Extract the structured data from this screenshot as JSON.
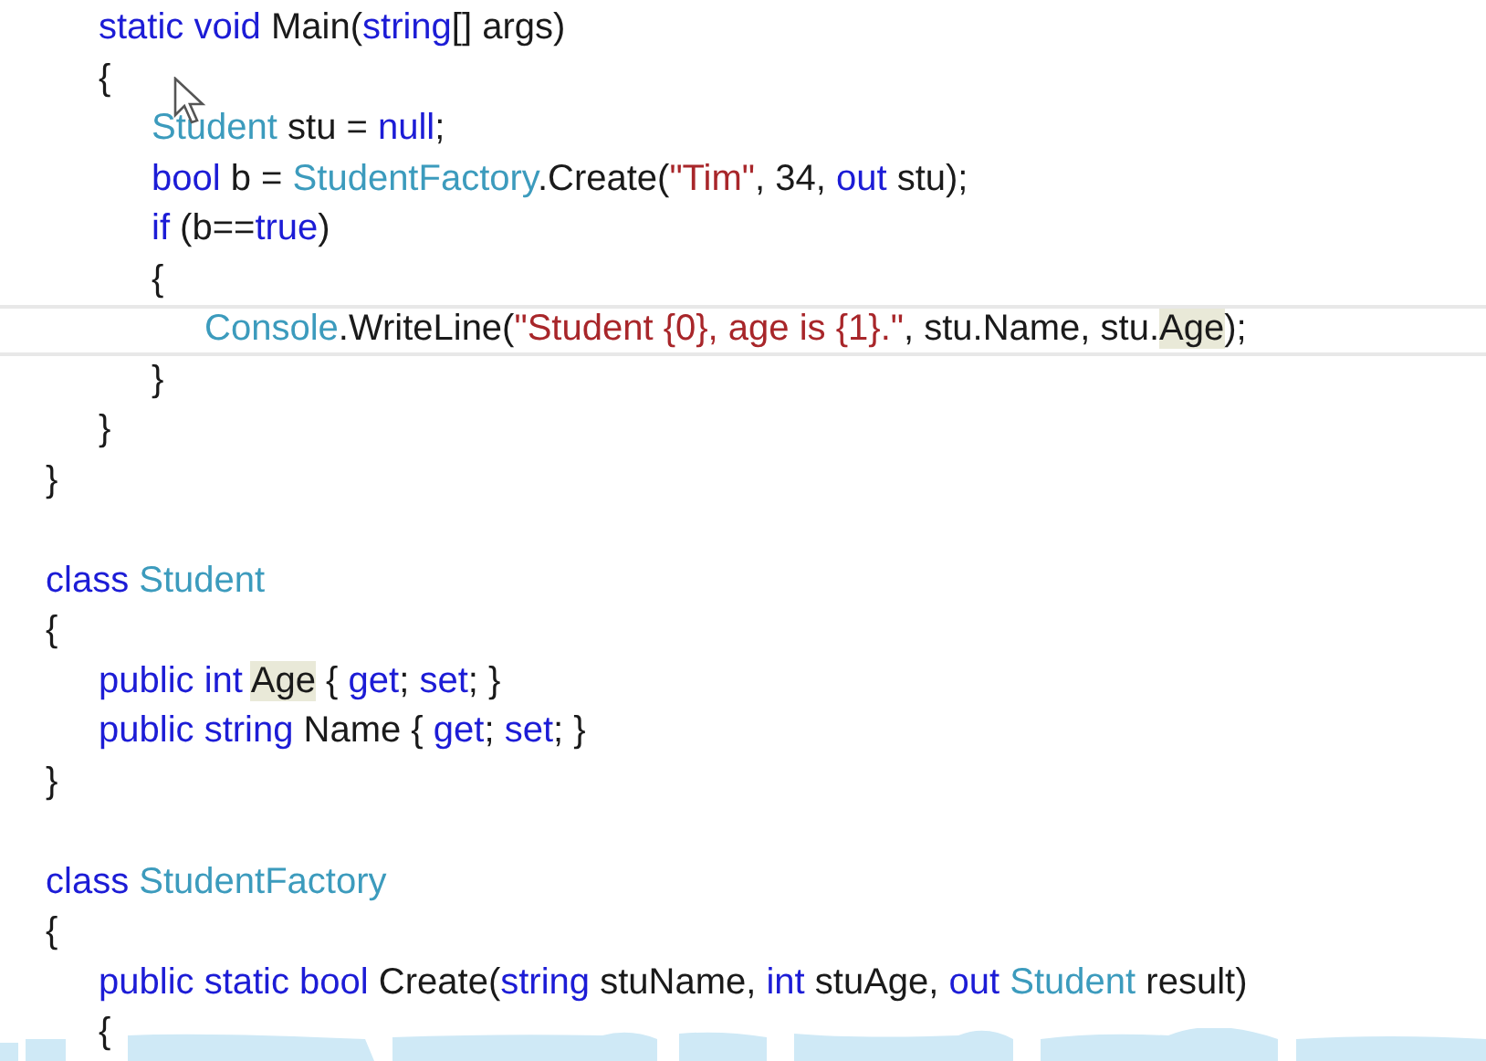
{
  "editor": {
    "lines": [
      {
        "kind": "block",
        "children": [
          {
            "kind": "line",
            "tokens": [
              {
                "text": "static void",
                "kind": "keyword"
              },
              {
                "text": " Main(",
                "kind": "plain"
              },
              {
                "text": "string",
                "kind": "keyword"
              },
              {
                "text": "[] args)",
                "kind": "plain"
              }
            ]
          },
          {
            "kind": "line",
            "tokens": [
              {
                "text": "{",
                "kind": "plain"
              }
            ]
          },
          {
            "kind": "block",
            "children": [
              {
                "kind": "line",
                "tokens": [
                  {
                    "text": "Student",
                    "kind": "type"
                  },
                  {
                    "text": " stu = ",
                    "kind": "plain"
                  },
                  {
                    "text": "null",
                    "kind": "keyword"
                  },
                  {
                    "text": ";",
                    "kind": "plain"
                  }
                ]
              },
              {
                "kind": "line",
                "tokens": [
                  {
                    "text": "bool",
                    "kind": "keyword"
                  },
                  {
                    "text": " b = ",
                    "kind": "plain"
                  },
                  {
                    "text": "StudentFactory",
                    "kind": "type"
                  },
                  {
                    "text": ".Create(",
                    "kind": "plain"
                  },
                  {
                    "text": "\"Tim\"",
                    "kind": "string"
                  },
                  {
                    "text": ", 34, ",
                    "kind": "plain"
                  },
                  {
                    "text": "out",
                    "kind": "keyword"
                  },
                  {
                    "text": " stu);",
                    "kind": "plain"
                  }
                ]
              },
              {
                "kind": "line",
                "tokens": [
                  {
                    "text": "if",
                    "kind": "keyword"
                  },
                  {
                    "text": " (b==",
                    "kind": "plain"
                  },
                  {
                    "text": "true",
                    "kind": "keyword"
                  },
                  {
                    "text": ")",
                    "kind": "plain"
                  }
                ]
              },
              {
                "kind": "line",
                "tokens": [
                  {
                    "text": "{",
                    "kind": "plain"
                  }
                ]
              },
              {
                "kind": "block",
                "children": [
                  {
                    "kind": "line",
                    "current": true,
                    "tokens": [
                      {
                        "text": "Console",
                        "kind": "type"
                      },
                      {
                        "text": ".WriteLine(",
                        "kind": "plain"
                      },
                      {
                        "text": "\"Student {0}, age is {1}.\"",
                        "kind": "string"
                      },
                      {
                        "text": ", stu.Name, stu.",
                        "kind": "plain"
                      },
                      {
                        "text": "Age",
                        "kind": "plain",
                        "highlighted": true
                      },
                      {
                        "text": ");",
                        "kind": "plain"
                      }
                    ]
                  }
                ]
              },
              {
                "kind": "line",
                "tokens": [
                  {
                    "text": "}",
                    "kind": "plain"
                  }
                ]
              }
            ]
          },
          {
            "kind": "line",
            "tokens": [
              {
                "text": "}",
                "kind": "plain"
              }
            ]
          }
        ]
      },
      {
        "kind": "line",
        "tokens": [
          {
            "text": "}",
            "kind": "plain"
          }
        ]
      },
      {
        "kind": "blank"
      },
      {
        "kind": "line",
        "tokens": [
          {
            "text": "class",
            "kind": "keyword"
          },
          {
            "text": " Student",
            "kind": "type"
          }
        ]
      },
      {
        "kind": "line",
        "tokens": [
          {
            "text": "{",
            "kind": "plain"
          }
        ]
      },
      {
        "kind": "block",
        "children": [
          {
            "kind": "line",
            "tokens": [
              {
                "text": "public int ",
                "kind": "keyword"
              },
              {
                "text": "Age",
                "kind": "plain",
                "highlighted": true
              },
              {
                "text": " { ",
                "kind": "plain"
              },
              {
                "text": "get",
                "kind": "keyword"
              },
              {
                "text": "; ",
                "kind": "plain"
              },
              {
                "text": "set",
                "kind": "keyword"
              },
              {
                "text": "; }",
                "kind": "plain"
              }
            ]
          },
          {
            "kind": "line",
            "tokens": [
              {
                "text": "public string",
                "kind": "keyword"
              },
              {
                "text": " Name { ",
                "kind": "plain"
              },
              {
                "text": "get",
                "kind": "keyword"
              },
              {
                "text": "; ",
                "kind": "plain"
              },
              {
                "text": "set",
                "kind": "keyword"
              },
              {
                "text": "; }",
                "kind": "plain"
              }
            ]
          }
        ]
      },
      {
        "kind": "line",
        "tokens": [
          {
            "text": "}",
            "kind": "plain"
          }
        ]
      },
      {
        "kind": "blank"
      },
      {
        "kind": "line",
        "tokens": [
          {
            "text": "class",
            "kind": "keyword"
          },
          {
            "text": " StudentFactory",
            "kind": "type"
          }
        ]
      },
      {
        "kind": "line",
        "tokens": [
          {
            "text": "{",
            "kind": "plain"
          }
        ]
      },
      {
        "kind": "block",
        "children": [
          {
            "kind": "line",
            "tokens": [
              {
                "text": "public static bool",
                "kind": "keyword"
              },
              {
                "text": " Create(",
                "kind": "plain"
              },
              {
                "text": "string",
                "kind": "keyword"
              },
              {
                "text": " stuName, ",
                "kind": "plain"
              },
              {
                "text": "int",
                "kind": "keyword"
              },
              {
                "text": " stuAge, ",
                "kind": "plain"
              },
              {
                "text": "out ",
                "kind": "keyword"
              },
              {
                "text": "Student",
                "kind": "type"
              },
              {
                "text": " result)",
                "kind": "plain"
              }
            ]
          },
          {
            "kind": "line",
            "tokens": [
              {
                "text": "{",
                "kind": "plain"
              }
            ]
          }
        ]
      }
    ]
  }
}
